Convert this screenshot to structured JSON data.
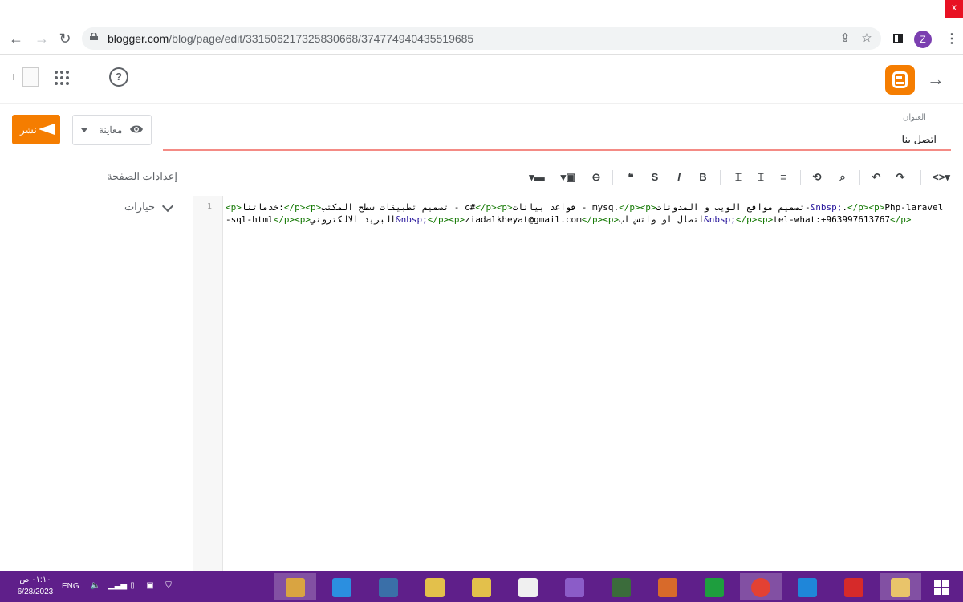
{
  "browser": {
    "url_host": "blogger.com",
    "url_path": "/blog/page/edit/3315062173258306​68/374774940435519685",
    "profile_initial": "Z",
    "close_glyph": "x"
  },
  "header": {
    "help_glyph": "?"
  },
  "page": {
    "title_label": "العنوان",
    "title_value": "اتصل بنا",
    "publish_label": "نشر",
    "preview_label": "معاينة"
  },
  "sidebar": {
    "settings_title": "إعدادات الصفحة",
    "options_label": "خيارات"
  },
  "editor": {
    "line_number": "1",
    "toolbar": {
      "html_toggle": "<>",
      "undo": "↶",
      "redo": "↷",
      "search": "⌕",
      "replace": "⟲",
      "align": "≡",
      "quote": "❝",
      "strike": "S",
      "italic": "I",
      "bold": "B",
      "link": "⊖",
      "image": "▣",
      "video": "▬"
    },
    "code_parts": [
      {
        "t": "tag",
        "v": "<p>"
      },
      {
        "t": "txt",
        "v": "خدماتنا:"
      },
      {
        "t": "tag",
        "v": "</p>"
      },
      {
        "t": "tag",
        "v": "<p>"
      },
      {
        "t": "txt",
        "v": "تصميم تطبيقات سطح المكتب - c#"
      },
      {
        "t": "tag",
        "v": "</p>"
      },
      {
        "t": "tag",
        "v": "<p>"
      },
      {
        "t": "txt",
        "v": "قواعد بيانات - mysq."
      },
      {
        "t": "tag",
        "v": "</p>"
      },
      {
        "t": "tag",
        "v": "<p>"
      },
      {
        "t": "txt",
        "v": "تصميم مواقع الويب و المدونات-"
      },
      {
        "t": "ent",
        "v": "&nbsp;"
      },
      {
        "t": "txt",
        "v": "."
      },
      {
        "t": "tag",
        "v": "</p>"
      },
      {
        "t": "tag",
        "v": "<p>"
      },
      {
        "t": "txt",
        "v": "Php-laravel-sql-html"
      },
      {
        "t": "tag",
        "v": "</p>"
      },
      {
        "t": "tag",
        "v": "<p>"
      },
      {
        "t": "txt",
        "v": "البريد الالكتروني"
      },
      {
        "t": "ent",
        "v": "&nbsp;"
      },
      {
        "t": "tag",
        "v": "</p>"
      },
      {
        "t": "tag",
        "v": "<p>"
      },
      {
        "t": "txt",
        "v": "ziadalkheyat@gmail.com"
      },
      {
        "t": "tag",
        "v": "</p>"
      },
      {
        "t": "tag",
        "v": "<p>"
      },
      {
        "t": "txt",
        "v": "اتصال او واتس اب"
      },
      {
        "t": "ent",
        "v": "&nbsp;"
      },
      {
        "t": "tag",
        "v": "</p>"
      },
      {
        "t": "tag",
        "v": "<p>"
      },
      {
        "t": "txt",
        "v": "tel-what:+963997613767"
      },
      {
        "t": "tag",
        "v": "</p>"
      }
    ]
  },
  "taskbar": {
    "time": "٠١:١٠ ص",
    "date": "6/28/2023",
    "language": "ENG",
    "apps": [
      {
        "name": "paint-app",
        "color": "#d9a441"
      },
      {
        "name": "vscode-app",
        "color": "#2b8fe0"
      },
      {
        "name": "python-idle-app",
        "color": "#3a6fa8"
      },
      {
        "name": "python-file-app",
        "color": "#e3c04b"
      },
      {
        "name": "python-file-app-2",
        "color": "#e3c04b"
      },
      {
        "name": "notepad-app",
        "color": "#f0f0f0"
      },
      {
        "name": "visual-studio-app",
        "color": "#8b5cc8"
      },
      {
        "name": "calculator-app",
        "color": "#3b6c3b"
      },
      {
        "name": "snipping-tool-app",
        "color": "#d86a2a"
      },
      {
        "name": "store-app",
        "color": "#1e9e3e"
      },
      {
        "name": "chrome-app",
        "color": "#e34133"
      },
      {
        "name": "edge-app",
        "color": "#1f86d9"
      },
      {
        "name": "recorder-app",
        "color": "#d62a2a"
      },
      {
        "name": "file-explorer-app",
        "color": "#e9c46a"
      }
    ]
  }
}
